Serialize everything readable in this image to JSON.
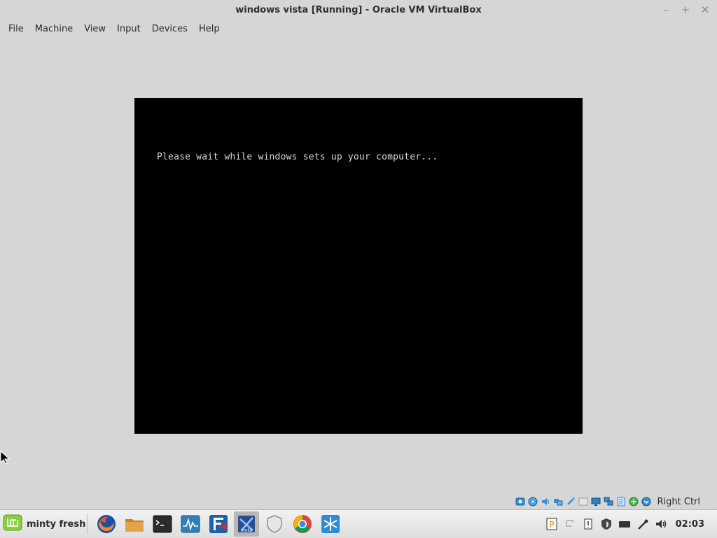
{
  "window": {
    "title": "windows vista [Running] - Oracle VM VirtualBox"
  },
  "menubar": {
    "items": [
      "File",
      "Machine",
      "View",
      "Input",
      "Devices",
      "Help"
    ]
  },
  "vm": {
    "message": "Please wait while windows sets up your computer..."
  },
  "status_bar": {
    "host_key": "Right Ctrl",
    "icons": [
      "hard-disk-icon",
      "optical-disk-icon",
      "audio-icon",
      "network-icon",
      "usb-icon",
      "shared-folders-icon",
      "display-icon",
      "video-capture-icon",
      "mouse-integration-icon",
      "cpu-icon",
      "keyboard-icon"
    ]
  },
  "panel": {
    "menu_label": "minty fresh",
    "launchers": [
      "firefox-icon",
      "files-icon",
      "terminal-icon",
      "system-monitor-icon",
      "filezilla-icon",
      "vista-vm-icon",
      "shield-icon",
      "chrome-icon",
      "snowflake-icon"
    ],
    "tray_icons": [
      "parcellite-icon",
      "update-icon",
      "notification-icon",
      "security-icon",
      "keyboard-icon",
      "network-icon",
      "volume-icon"
    ],
    "clock": "02:03"
  },
  "colors": {
    "window_bg": "#d6d6d6",
    "vm_screen_bg": "#000000",
    "vm_text": "#d8d8d8"
  }
}
